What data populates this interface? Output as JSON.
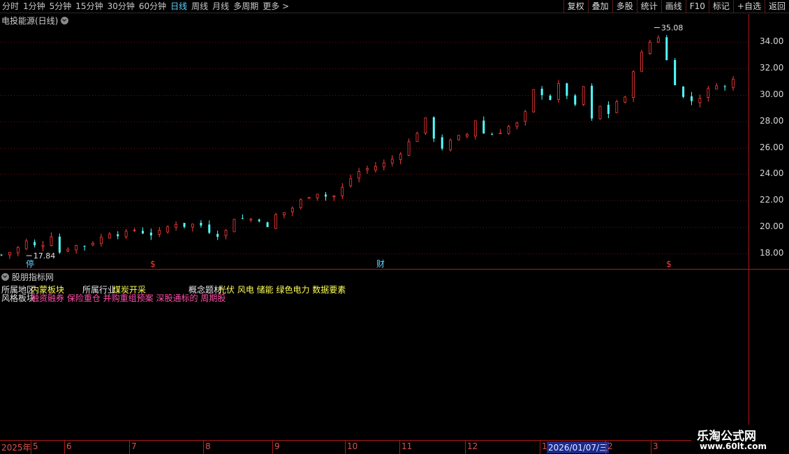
{
  "periods": [
    {
      "label": "分时",
      "active": false
    },
    {
      "label": "1分钟",
      "active": false
    },
    {
      "label": "5分钟",
      "active": false
    },
    {
      "label": "15分钟",
      "active": false
    },
    {
      "label": "30分钟",
      "active": false
    },
    {
      "label": "60分钟",
      "active": false
    },
    {
      "label": "日线",
      "active": true
    },
    {
      "label": "周线",
      "active": false
    },
    {
      "label": "月线",
      "active": false
    },
    {
      "label": "多周期",
      "active": false
    },
    {
      "label": "更多 >",
      "active": false
    }
  ],
  "tools": [
    "复权",
    "叠加",
    "多股",
    "统计",
    "画线",
    "F10",
    "标记",
    "+自选",
    "返回"
  ],
  "chart": {
    "title": "电投能源(日线)",
    "high_label": "35.08",
    "low_label": "17.84",
    "markers": [
      "停",
      "$",
      "财",
      "$"
    ],
    "up_color": "#ff3b3b",
    "down_color": "#54ffff"
  },
  "price_axis": [
    "34.00",
    "32.00",
    "30.00",
    "28.00",
    "26.00",
    "24.00",
    "22.00",
    "20.00",
    "18.00"
  ],
  "indicator": {
    "title": "股朋指标网",
    "region_label": "所属地区",
    "region_value": "内蒙板块",
    "industry_label": "所属行业",
    "industry_value": "煤炭开采",
    "concept_label": "概念题材",
    "concept_value": "光伏 风电 储能 绿色电力 数据要素",
    "style_label": "风格板块",
    "style_value": "融资融券 保险重仓 并购重组预案 深股通标的 周期股"
  },
  "date_axis": [
    "2025年",
    "5",
    "6",
    "7",
    "8",
    "9",
    "10",
    "11",
    "12",
    "1",
    "2026/01/07/三",
    "2",
    "3"
  ],
  "watermark": {
    "top": "乐淘公式网",
    "bottom": "www.60lt.com"
  },
  "chart_data": {
    "type": "candlestick",
    "title": "电投能源(日线)",
    "ylim": [
      17.2,
      35.6
    ],
    "y_ticks": [
      18,
      20,
      22,
      24,
      26,
      28,
      30,
      32,
      34
    ],
    "grid": true,
    "annotations": [
      {
        "text": "35.08",
        "type": "high"
      },
      {
        "text": "17.84",
        "type": "low"
      }
    ],
    "close_path": [
      [
        0,
        17.9
      ],
      [
        6,
        18.2
      ],
      [
        12,
        18.9
      ],
      [
        18,
        18.4
      ],
      [
        24,
        19.4
      ],
      [
        28,
        18.1
      ],
      [
        34,
        18.6
      ],
      [
        40,
        18.6
      ],
      [
        46,
        19.0
      ],
      [
        52,
        19.6
      ],
      [
        58,
        19.4
      ],
      [
        64,
        19.8
      ],
      [
        70,
        19.5
      ],
      [
        74,
        19.4
      ],
      [
        80,
        20.0
      ],
      [
        84,
        20.3
      ],
      [
        88,
        20.1
      ],
      [
        92,
        20.2
      ],
      [
        98,
        20.1
      ],
      [
        102,
        19.3
      ],
      [
        108,
        19.7
      ],
      [
        112,
        20.7
      ],
      [
        118,
        20.6
      ],
      [
        124,
        20.6
      ],
      [
        128,
        19.9
      ],
      [
        132,
        20.9
      ],
      [
        138,
        21.2
      ],
      [
        142,
        21.7
      ],
      [
        146,
        22.3
      ],
      [
        152,
        22.6
      ],
      [
        158,
        22.2
      ],
      [
        162,
        22.5
      ],
      [
        166,
        23.4
      ],
      [
        172,
        24.2
      ],
      [
        178,
        24.5
      ],
      [
        184,
        24.8
      ],
      [
        190,
        25.3
      ],
      [
        196,
        26.4
      ],
      [
        200,
        27.2
      ],
      [
        204,
        28.1
      ],
      [
        208,
        26.8
      ],
      [
        212,
        26.0
      ],
      [
        218,
        26.7
      ],
      [
        224,
        27.0
      ],
      [
        228,
        28.1
      ],
      [
        232,
        27.1
      ],
      [
        238,
        27.0
      ],
      [
        242,
        27.5
      ],
      [
        248,
        27.8
      ],
      [
        252,
        28.6
      ],
      [
        256,
        30.3
      ],
      [
        260,
        30.1
      ],
      [
        264,
        29.7
      ],
      [
        268,
        30.7
      ],
      [
        272,
        30.0
      ],
      [
        276,
        29.1
      ],
      [
        280,
        30.6
      ],
      [
        284,
        28.1
      ],
      [
        288,
        29.1
      ],
      [
        292,
        28.6
      ],
      [
        296,
        29.5
      ],
      [
        300,
        29.7
      ],
      [
        304,
        31.9
      ],
      [
        308,
        33.1
      ],
      [
        312,
        34.0
      ],
      [
        314,
        35.0
      ],
      [
        318,
        33.8
      ],
      [
        322,
        31.4
      ],
      [
        326,
        30.4
      ],
      [
        330,
        29.2
      ],
      [
        334,
        29.9
      ],
      [
        338,
        29.8
      ],
      [
        342,
        30.9
      ],
      [
        346,
        30.8
      ],
      [
        350,
        30.4
      ],
      [
        354,
        31.9
      ]
    ],
    "series_days": 354
  }
}
